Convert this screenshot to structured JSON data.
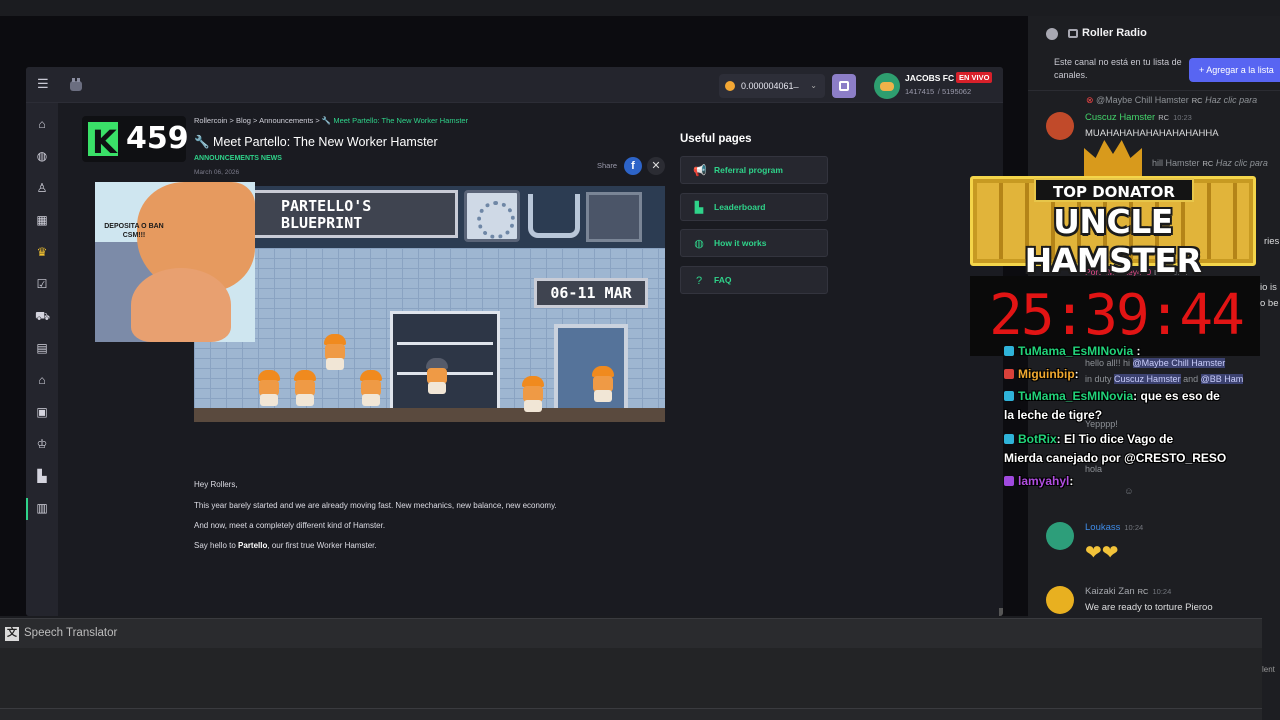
{
  "site": {
    "balance": "0.000004061 ̶",
    "user_name": "JACOBS FC",
    "user_stats": "1417415  / 5195062",
    "live_badge": "EN VIVO",
    "level_badge": "459"
  },
  "nav_icons": [
    "home-icon",
    "gamepad-icon",
    "user-icon",
    "calendar-icon",
    "crown-icon",
    "checklist-icon",
    "cart-icon",
    "storage-icon",
    "warehouse-icon",
    "gift-icon",
    "trophy-icon",
    "podium-icon",
    "blog-icon"
  ],
  "article": {
    "breadcrumb": [
      "Rollercoin",
      "Blog",
      "Announcements",
      "Meet Partello: The New Worker Hamster"
    ],
    "breadcrumb_sep": ">",
    "title": "Meet Partello: The New Worker Hamster",
    "category": "ANNOUNCEMENTS NEWS",
    "date": "March 06, 2026",
    "share_label": "Share",
    "banner_title": "PARTELLO'S\nBLUEPRINT",
    "banner_dates": "06-11 MAR",
    "paragraphs": [
      "Hey Rollers,",
      "This year barely started and we are already moving fast. New mechanics, new balance, new economy.",
      "And now, meet a completely different kind of Hamster."
    ],
    "final_prefix": "Say hello to ",
    "final_bold": "Partello",
    "final_suffix": ", our first true Worker Hamster."
  },
  "useful": {
    "title": "Useful pages",
    "items": [
      {
        "label": "Referral program",
        "icon": "megaphone-icon"
      },
      {
        "label": "Leaderboard",
        "icon": "leaderboard-icon"
      },
      {
        "label": "How it works",
        "icon": "gamepad-icon"
      },
      {
        "label": "FAQ",
        "icon": "question-icon"
      }
    ]
  },
  "meme": {
    "caption": "DEPOSITA O BAN CSM!!!"
  },
  "chat": {
    "channel": "Roller Radio",
    "notice": "Este canal no está en tu lista de canales.",
    "add_button": "+ Agregar a la lista",
    "messages": {
      "reply1_user": "@Maybe Chill Hamster",
      "reply1_text": "Haz clic para",
      "m1_user": "Cuscuz Hamster",
      "m1_time": "10:23",
      "m1_text": "MUAHAHAHAHAHAHAHAHHA",
      "reply2_user": "hill Hamster",
      "reply2_text": "Haz clic para",
      "partial1": "ries",
      "partial2": "PorchMonkey420",
      "partial2_time": "10:24",
      "partial3": "io is",
      "partial4": "o be",
      "r_hello": "hello all!! hi",
      "r_hello_mention": "@Maybe Chill Hamster",
      "r_duty": "in duty",
      "r_duty_m1": "Cuscuz Hamster",
      "r_duty_and": "and",
      "r_duty_m2": "@BB Ham",
      "r_yep": "Yepppp!",
      "r_hola": "hola",
      "loukass_user": "Loukass",
      "loukass_time": "10:24",
      "kaizaki_user": "Kaizaki Zan",
      "kaizaki_time": "10:24",
      "kaizaki_text": "We are ready to torture Pieroo",
      "rc_tag": "RC"
    }
  },
  "overlay": {
    "donator_top": "TOP DONATOR",
    "donator_name": "UNCLE HAMSTER",
    "timer": "25:39:44",
    "chat": [
      {
        "user": "TuMama_EsMINovia",
        "text": " :"
      },
      {
        "user": "Miguinbip",
        "text": ":"
      },
      {
        "user": "TuMama_EsMINovia",
        "text": ": que es eso de"
      },
      {
        "user": "",
        "text": "la leche de tigre?"
      },
      {
        "user": "BotRix",
        "text": ": El Tio dice Vago de"
      },
      {
        "user": "",
        "text": "Mierda canejado por @CRESTO_RESO"
      },
      {
        "user": "lamyahyl",
        "text": ":"
      }
    ]
  },
  "translator": {
    "label": "Speech Translator"
  },
  "edge_text": "lent"
}
